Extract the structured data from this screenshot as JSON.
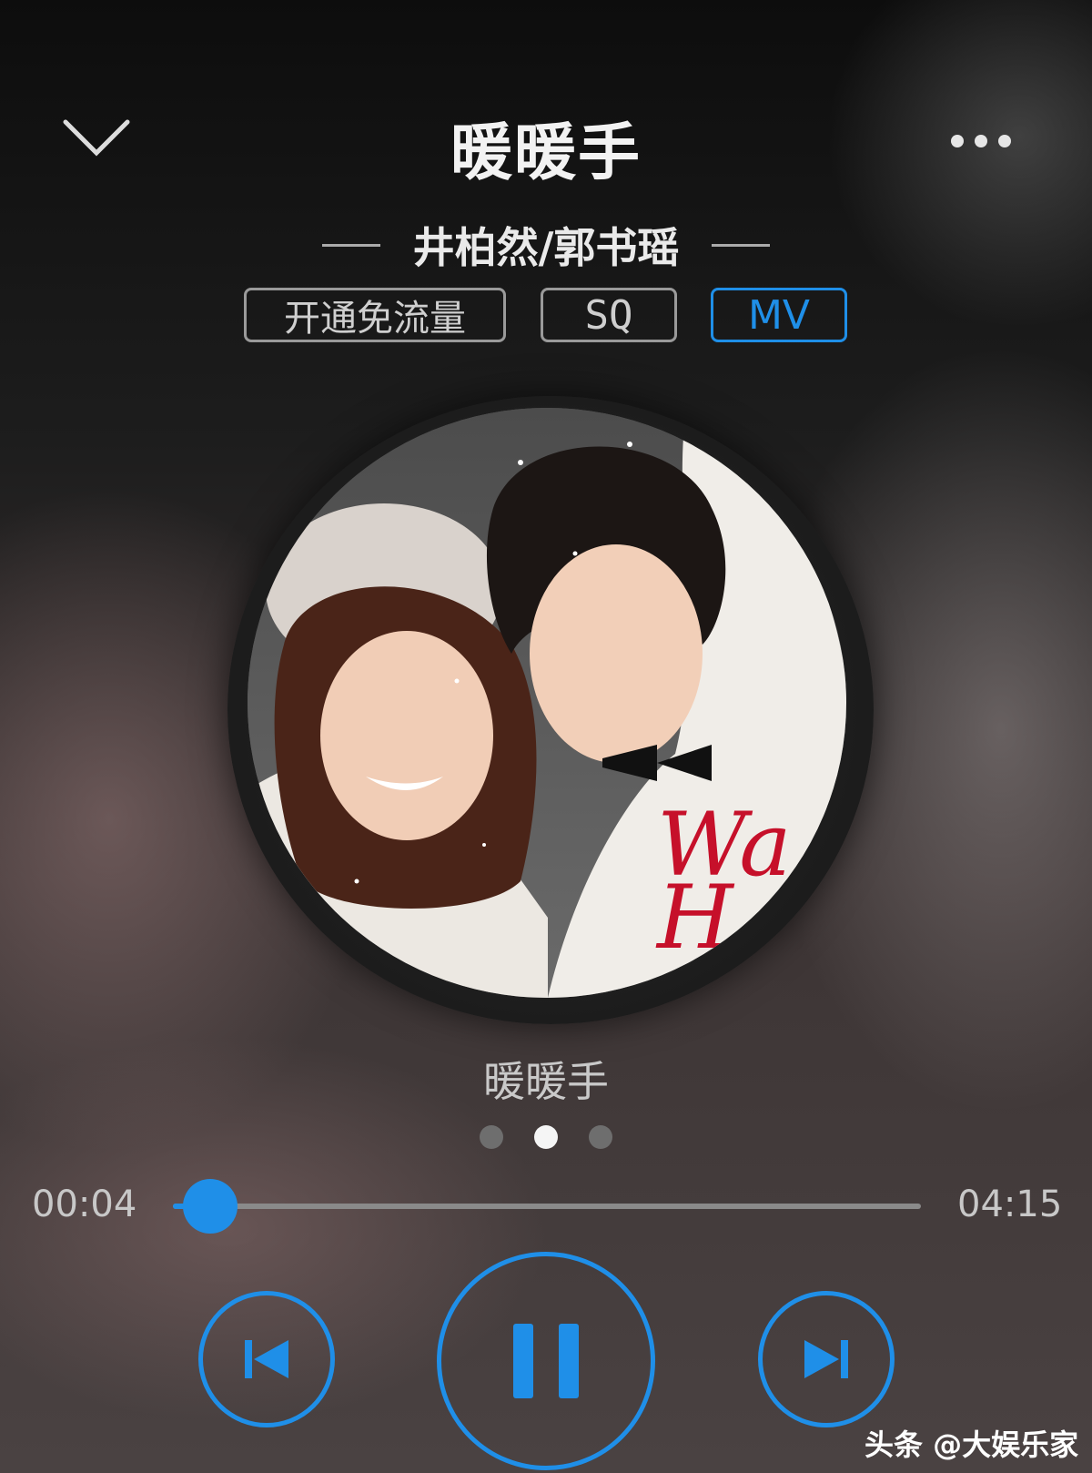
{
  "header": {
    "title": "暖暖手",
    "artist": "井柏然/郭书瑶"
  },
  "tags": {
    "free_data": "开通免流量",
    "quality": "SQ",
    "mv": "MV"
  },
  "album": {
    "cover_text": "Wa\nH"
  },
  "now_playing": {
    "subtitle": "暖暖手"
  },
  "pager": {
    "count": 3,
    "active_index": 1
  },
  "progress": {
    "current": "00:04",
    "total": "04:15",
    "fraction": 0.016
  },
  "watermark": "头条 @大娱乐家",
  "colors": {
    "accent": "#1f8fe8",
    "text": "#f2f2f2"
  },
  "icons": {
    "down": "chevron-down-icon",
    "more": "more-dots-icon",
    "prev": "skip-previous-icon",
    "pause": "pause-icon",
    "next": "skip-next-icon"
  }
}
